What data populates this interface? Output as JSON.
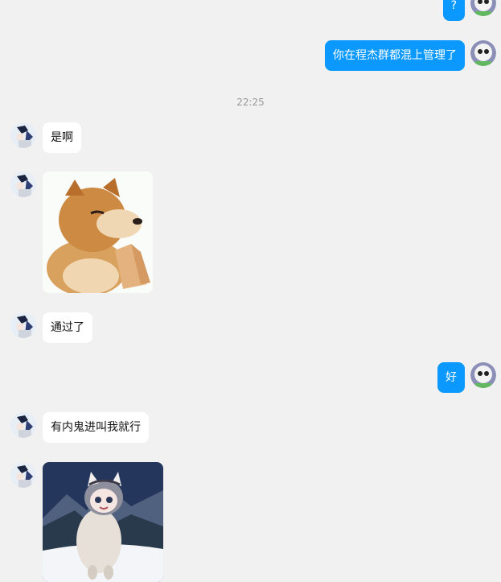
{
  "conversation": {
    "messages": [
      {
        "side": "me",
        "type": "text",
        "text": "?"
      },
      {
        "side": "me",
        "type": "text",
        "text": "你在程杰群都混上管理了"
      },
      {
        "type": "timestamp",
        "text": "22:25"
      },
      {
        "side": "other",
        "type": "text",
        "text": "是啊"
      },
      {
        "side": "other",
        "type": "sticker",
        "sticker": "shiba-dog-praying-sticker"
      },
      {
        "side": "other",
        "type": "text",
        "text": "通过了"
      },
      {
        "side": "me",
        "type": "text",
        "text": "好"
      },
      {
        "side": "other",
        "type": "text",
        "text": "有内鬼进叫我就行"
      },
      {
        "side": "other",
        "type": "sticker",
        "sticker": "anime-girl-alpaca-snow-sticker"
      }
    ]
  },
  "colors": {
    "background": "#f1f1f1",
    "my_bubble": "#0b99ff",
    "their_bubble": "#ffffff",
    "timestamp_text": "#999999"
  }
}
